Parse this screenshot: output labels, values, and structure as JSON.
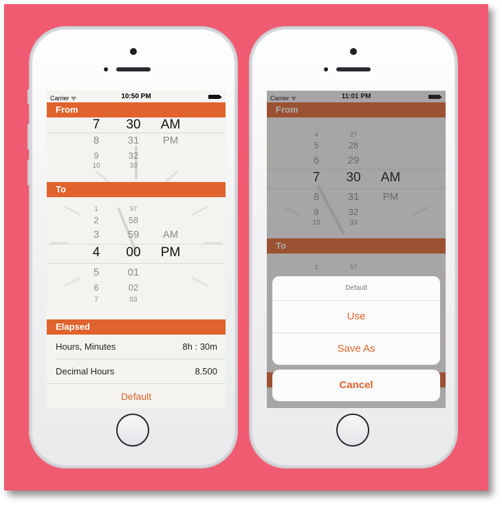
{
  "colors": {
    "background": "#f05b72",
    "accent": "#e0622c"
  },
  "left_screen": {
    "status": {
      "carrier": "Carrier ᯤ",
      "time": "10:50 PM"
    },
    "from_header": "From",
    "from_picker": {
      "rows": [
        {
          "h": "7",
          "m": "30",
          "ap": "AM"
        },
        {
          "h": "8",
          "m": "31",
          "ap": "PM"
        },
        {
          "h": "9",
          "m": "32",
          "ap": ""
        },
        {
          "h": "10",
          "m": "33",
          "ap": ""
        }
      ]
    },
    "to_header": "To",
    "to_picker": {
      "rows": [
        {
          "h": "1",
          "m": "57",
          "ap": ""
        },
        {
          "h": "2",
          "m": "58",
          "ap": ""
        },
        {
          "h": "3",
          "m": "59",
          "ap": "AM"
        },
        {
          "h": "4",
          "m": "00",
          "ap": "PM"
        },
        {
          "h": "5",
          "m": "01",
          "ap": ""
        },
        {
          "h": "6",
          "m": "02",
          "ap": ""
        },
        {
          "h": "7",
          "m": "03",
          "ap": ""
        }
      ]
    },
    "elapsed_header": "Elapsed",
    "elapsed": [
      {
        "label": "Hours, Minutes",
        "value": "8h : 30m"
      },
      {
        "label": "Decimal Hours",
        "value": "8.500"
      }
    ],
    "default_label": "Default"
  },
  "right_screen": {
    "status": {
      "carrier": "Carrier ᯤ",
      "time": "11:01 PM"
    },
    "from_header": "From",
    "from_picker": {
      "rows": [
        {
          "h": "4",
          "m": "27",
          "ap": ""
        },
        {
          "h": "5",
          "m": "28",
          "ap": ""
        },
        {
          "h": "6",
          "m": "29",
          "ap": ""
        },
        {
          "h": "7",
          "m": "30",
          "ap": "AM"
        },
        {
          "h": "8",
          "m": "31",
          "ap": "PM"
        },
        {
          "h": "9",
          "m": "32",
          "ap": ""
        },
        {
          "h": "10",
          "m": "33",
          "ap": ""
        }
      ]
    },
    "to_header": "To",
    "to_partial": {
      "h": "1",
      "m": "57"
    },
    "action_sheet": {
      "title": "Default",
      "options": [
        "Use",
        "Save As"
      ],
      "cancel": "Cancel"
    }
  }
}
